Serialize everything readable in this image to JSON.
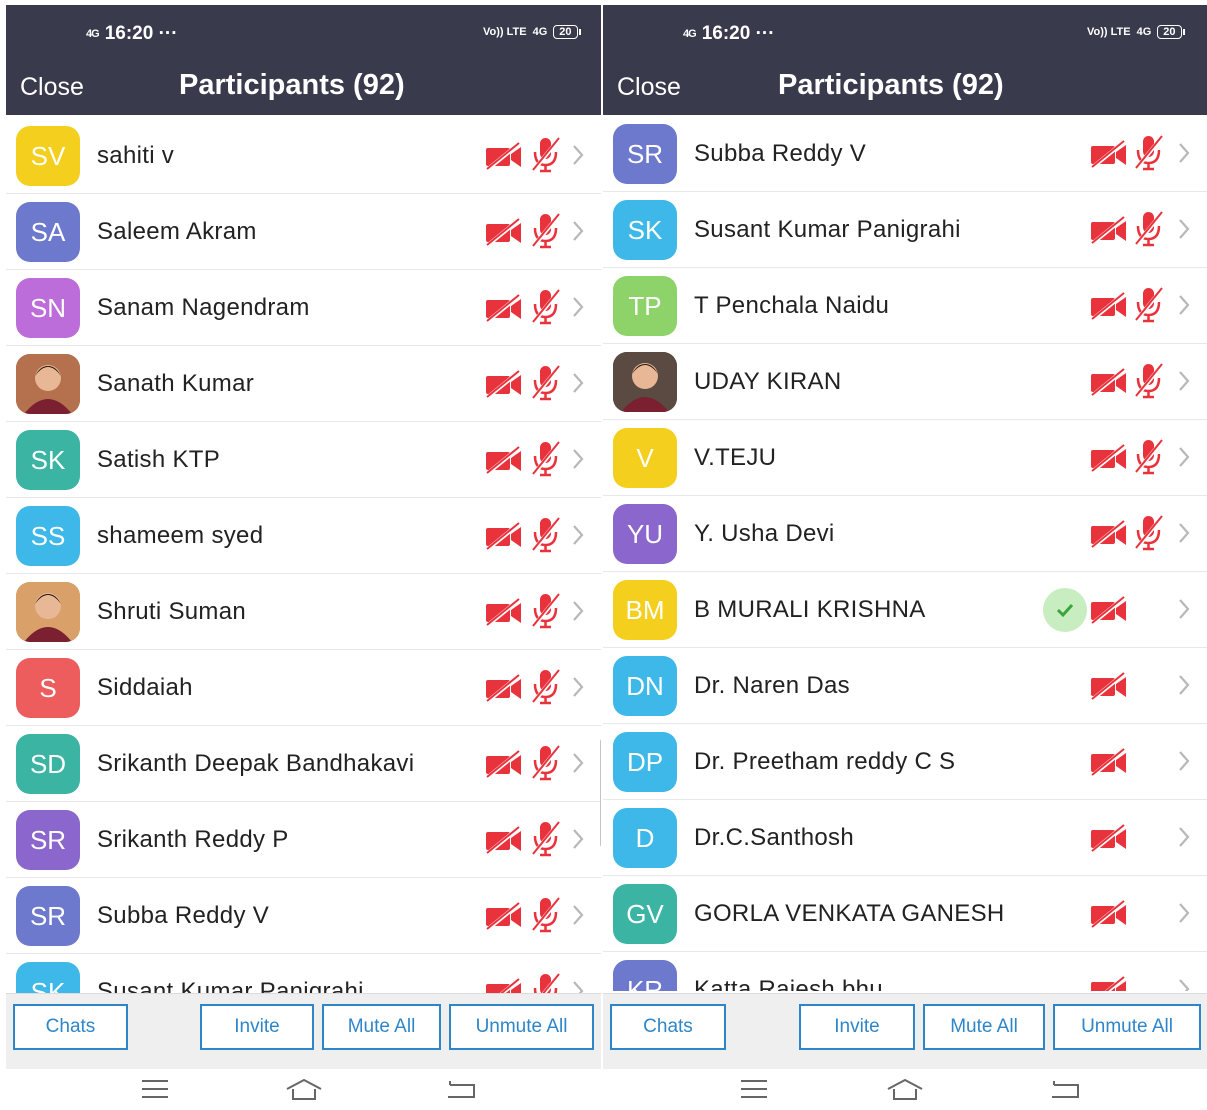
{
  "colors": {
    "header_bg": "#393a4b",
    "accent": "#2e86c8",
    "muted_red": "#e8323c",
    "chevron": "#b8b8b8",
    "check_bg": "#c8edc0",
    "check_mark": "#3aa53a"
  },
  "left": {
    "status": {
      "signal": "4G",
      "time": "16:20",
      "dots": "···",
      "volte": "Vo)) LTE",
      "network": "4G",
      "battery": "20"
    },
    "header": {
      "close": "Close",
      "title": "Participants (92)"
    },
    "participants": [
      {
        "initials": "SV",
        "name": "sahiti v",
        "color": "#f5cf1d",
        "video_muted": true,
        "audio_muted": true
      },
      {
        "initials": "SA",
        "name": "Saleem Akram",
        "color": "#6d79cc",
        "video_muted": true,
        "audio_muted": true
      },
      {
        "initials": "SN",
        "name": "Sanam Nagendram",
        "color": "#bd6dd9",
        "video_muted": true,
        "audio_muted": true
      },
      {
        "initials": "",
        "name": "Sanath Kumar",
        "color": "#b5714d",
        "photo": true,
        "video_muted": true,
        "audio_muted": true
      },
      {
        "initials": "SK",
        "name": "Satish KTP",
        "color": "#3cb4a3",
        "video_muted": true,
        "audio_muted": true
      },
      {
        "initials": "SS",
        "name": "shameem syed",
        "color": "#3db8e8",
        "video_muted": true,
        "audio_muted": true
      },
      {
        "initials": "",
        "name": "Shruti Suman",
        "color": "#d9a06a",
        "photo": true,
        "video_muted": true,
        "audio_muted": true
      },
      {
        "initials": "S",
        "name": "Siddaiah",
        "color": "#ee5d5d",
        "video_muted": true,
        "audio_muted": true
      },
      {
        "initials": "SD",
        "name": "Srikanth Deepak Bandhakavi",
        "color": "#3cb4a3",
        "video_muted": true,
        "audio_muted": true
      },
      {
        "initials": "SR",
        "name": "Srikanth Reddy P",
        "color": "#8b66cc",
        "video_muted": true,
        "audio_muted": true
      },
      {
        "initials": "SR",
        "name": "Subba Reddy V",
        "color": "#6d79cc",
        "video_muted": true,
        "audio_muted": true
      },
      {
        "initials": "SK",
        "name": "Susant Kumar Panigrahi",
        "color": "#3db8e8",
        "video_muted": true,
        "audio_muted": true
      }
    ],
    "toolbar": {
      "chats": "Chats",
      "invite": "Invite",
      "mute_all": "Mute All",
      "unmute_all": "Unmute All"
    }
  },
  "right": {
    "status": {
      "signal": "4G",
      "time": "16:20",
      "dots": "···",
      "volte": "Vo)) LTE",
      "network": "4G",
      "battery": "20"
    },
    "header": {
      "close": "Close",
      "title": "Participants (92)"
    },
    "participants": [
      {
        "initials": "SR",
        "name": "Subba Reddy V",
        "color": "#6d79cc",
        "video_muted": true,
        "audio_muted": true
      },
      {
        "initials": "SK",
        "name": "Susant Kumar Panigrahi",
        "color": "#3db8e8",
        "video_muted": true,
        "audio_muted": true
      },
      {
        "initials": "TP",
        "name": "T Penchala Naidu",
        "color": "#8dd36a",
        "video_muted": true,
        "audio_muted": true
      },
      {
        "initials": "",
        "name": "UDAY KIRAN",
        "color": "#5a4a42",
        "photo": true,
        "video_muted": true,
        "audio_muted": true
      },
      {
        "initials": "V",
        "name": "V.TEJU",
        "color": "#f5cf1d",
        "video_muted": true,
        "audio_muted": true
      },
      {
        "initials": "YU",
        "name": "Y. Usha Devi",
        "color": "#8b66cc",
        "video_muted": true,
        "audio_muted": true
      },
      {
        "initials": "BM",
        "name": "B MURALI KRISHNA",
        "color": "#f5cf1d",
        "video_muted": true,
        "audio_muted": false,
        "check": true
      },
      {
        "initials": "DN",
        "name": "Dr. Naren Das",
        "color": "#3db8e8",
        "video_muted": true,
        "audio_muted": false
      },
      {
        "initials": "DP",
        "name": "Dr. Preetham reddy C S",
        "color": "#3db8e8",
        "video_muted": true,
        "audio_muted": false
      },
      {
        "initials": "D",
        "name": "Dr.C.Santhosh",
        "color": "#3db8e8",
        "video_muted": true,
        "audio_muted": false
      },
      {
        "initials": "GV",
        "name": "GORLA VENKATA GANESH",
        "color": "#3cb4a3",
        "video_muted": true,
        "audio_muted": false
      },
      {
        "initials": "KR",
        "name": "Katta Rajesh bhu",
        "color": "#6d79cc",
        "video_muted": true,
        "audio_muted": false
      }
    ],
    "toolbar": {
      "chats": "Chats",
      "invite": "Invite",
      "mute_all": "Mute All",
      "unmute_all": "Unmute All"
    }
  }
}
